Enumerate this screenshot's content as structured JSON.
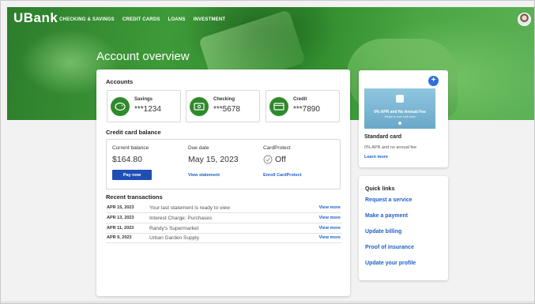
{
  "brand": {
    "logo": "UBank"
  },
  "nav": {
    "items": [
      "CHECKING & SAVINGS",
      "CREDIT CARDS",
      "LOANS",
      "INVESTMENT"
    ]
  },
  "page": {
    "title": "Account overview"
  },
  "accounts": {
    "heading": "Accounts",
    "items": [
      {
        "name": "Savings",
        "number": "***1234",
        "icon": "piggy-bank-icon"
      },
      {
        "name": "Checking",
        "number": "***5678",
        "icon": "cash-icon"
      },
      {
        "name": "Credit",
        "number": "***7890",
        "icon": "credit-card-icon"
      }
    ]
  },
  "credit_card": {
    "heading": "Credit card balance",
    "current_balance_label": "Current balance",
    "current_balance": "$164.80",
    "due_date_label": "Due date",
    "due_date": "May 15, 2023",
    "protect_label": "CardProtect",
    "protect_value": "Off",
    "pay_button": "Pay now",
    "view_statement": "View statement",
    "enroll": "Enroll CardProtect"
  },
  "transactions": {
    "heading": "Recent transactions",
    "rows": [
      {
        "date": "APR 15, 2023",
        "text": "Your last statement is ready to view",
        "action": "View more"
      },
      {
        "date": "APR 13, 2023",
        "text": "Interest Charge: Purchases",
        "action": "View more"
      },
      {
        "date": "APR 11, 2023",
        "text": "Randy's Supermarket",
        "action": "View more"
      },
      {
        "date": "APR 9, 2023",
        "text": "Urban Garden Supply",
        "action": "View more"
      }
    ]
  },
  "promo": {
    "image_line1": "0% APR and No Annual Fee",
    "image_line2": "Simple to earn cash back",
    "title": "Standard card",
    "desc": "0% APR and no annual fee",
    "link": "Learn more"
  },
  "quick_links": {
    "heading": "Quick links",
    "items": [
      "Request a service",
      "Make a payment",
      "Update billing",
      "Proof of insurance",
      "Update your profile"
    ]
  },
  "colors": {
    "brand_green": "#2f8a2c",
    "link_blue": "#1f5fc9",
    "button_blue": "#1f4fb3"
  }
}
